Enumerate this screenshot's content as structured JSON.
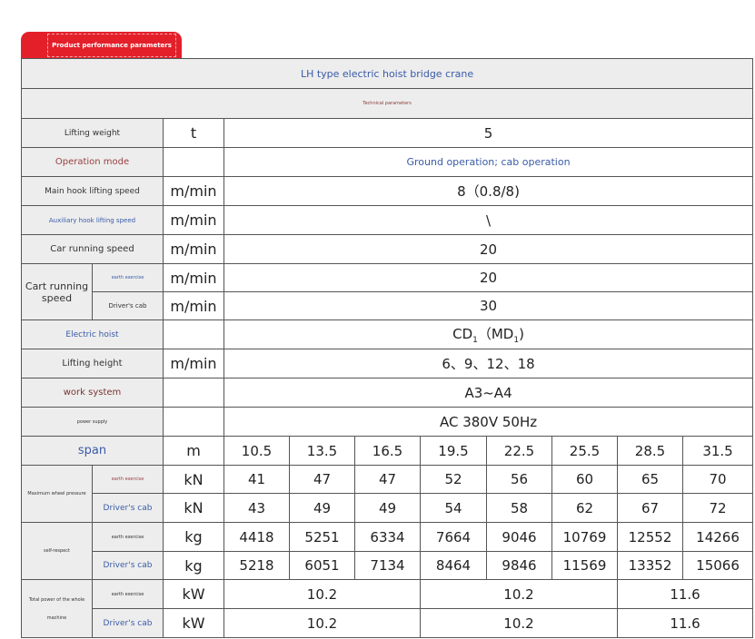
{
  "tab": {
    "label": "Product performance parameters"
  },
  "table": {
    "title": "LH type electric hoist bridge crane",
    "subtitle": "Technical parameters",
    "rows": {
      "lifting_weight": {
        "label": "Lifting weight",
        "unit": "t",
        "value": "5"
      },
      "operation_mode": {
        "label": "Operation mode",
        "unit": "",
        "value": "Ground operation; cab operation"
      },
      "main_hook_speed": {
        "label": "Main hook lifting speed",
        "unit": "m/min",
        "value": "8（0.8/8)"
      },
      "aux_hook_speed": {
        "label": "Auxiliary hook lifting speed",
        "unit": "m/min",
        "value": "\\"
      },
      "car_speed": {
        "label": "Car running speed",
        "unit": "m/min",
        "value": "20"
      },
      "cart_speed": {
        "label": "Cart running speed",
        "earth": {
          "label": "earth exercise",
          "unit": "m/min",
          "value": "20"
        },
        "cab": {
          "label": "Driver's cab",
          "unit": "m/min",
          "value": "30"
        }
      },
      "electric_hoist": {
        "label": "Electric hoist",
        "unit": "",
        "value_main": "CD",
        "value_sub1": "1",
        "value_mid": "（MD",
        "value_sub2": "1",
        "value_end": ")"
      },
      "lifting_height": {
        "label": "Lifting height",
        "unit": "m/min",
        "value": "6、9、12、18"
      },
      "work_system": {
        "label": "work system",
        "unit": "",
        "value": "A3~A4"
      },
      "power_supply": {
        "label": "power supply",
        "unit": "",
        "value": "AC 380V 50Hz"
      },
      "span": {
        "label": "span",
        "unit": "m",
        "values": [
          "10.5",
          "13.5",
          "16.5",
          "19.5",
          "22.5",
          "25.5",
          "28.5",
          "31.5"
        ]
      },
      "wheel_pressure": {
        "label": "Maximum wheel pressure",
        "earth": {
          "label": "earth exercise",
          "unit": "kN",
          "values": [
            "41",
            "47",
            "47",
            "52",
            "56",
            "60",
            "65",
            "70"
          ]
        },
        "cab": {
          "label": "Driver's cab",
          "unit": "kN",
          "values": [
            "43",
            "49",
            "49",
            "54",
            "58",
            "62",
            "67",
            "72"
          ]
        }
      },
      "self_respect": {
        "label": "self-respect",
        "earth": {
          "label": "earth exercise",
          "unit": "kg",
          "values": [
            "4418",
            "5251",
            "6334",
            "7664",
            "9046",
            "10769",
            "12552",
            "14266"
          ]
        },
        "cab": {
          "label": "Driver's cab",
          "unit": "kg",
          "values": [
            "5218",
            "6051",
            "7134",
            "8464",
            "9846",
            "11569",
            "13352",
            "15066"
          ]
        }
      },
      "total_power": {
        "label_line1": "Total power of the whole",
        "label_line2": "machine",
        "earth": {
          "label": "earth exercise",
          "unit": "kW",
          "values": [
            "10.2",
            "10.2",
            "11.6"
          ]
        },
        "cab": {
          "label": "Driver's cab",
          "unit": "kW",
          "values": [
            "10.2",
            "10.2",
            "11.6"
          ]
        }
      }
    }
  }
}
